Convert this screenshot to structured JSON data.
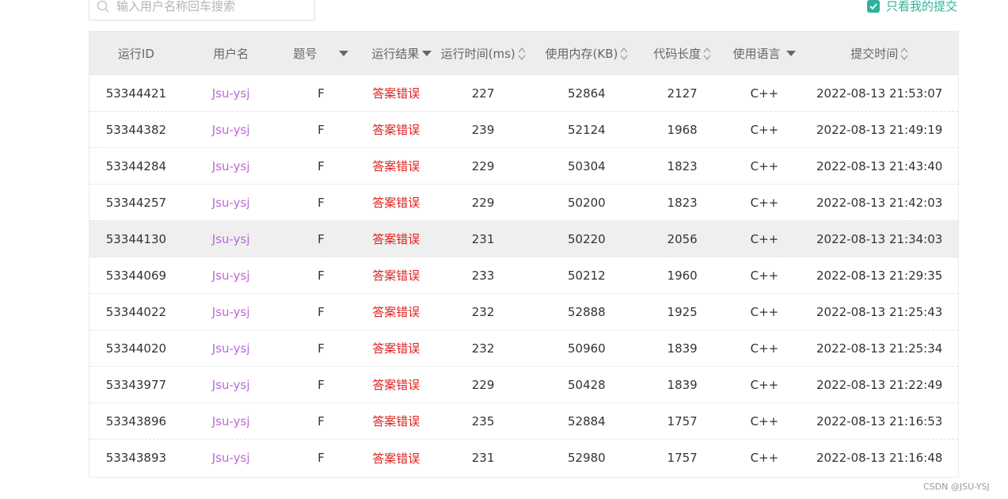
{
  "search": {
    "placeholder": "输入用户名称回车搜索"
  },
  "filter": {
    "only_mine_label": "只看我的提交",
    "checked": true
  },
  "colors": {
    "accent": "#2fb29b",
    "username": "#b96ad2",
    "result_error": "#e02020",
    "header_bg": "#ededed"
  },
  "table": {
    "headers": [
      "运行ID",
      "用户名",
      "题号",
      "运行结果",
      "运行时间(ms)",
      "使用内存(KB)",
      "代码长度",
      "使用语言",
      "提交时间"
    ],
    "rows": [
      {
        "id": "53344421",
        "user": "Jsu-ysj",
        "problem": "F",
        "result": "答案错误",
        "time": "227",
        "memory": "52864",
        "length": "2127",
        "lang": "C++",
        "submitted": "2022-08-13 21:53:07"
      },
      {
        "id": "53344382",
        "user": "Jsu-ysj",
        "problem": "F",
        "result": "答案错误",
        "time": "239",
        "memory": "52124",
        "length": "1968",
        "lang": "C++",
        "submitted": "2022-08-13 21:49:19"
      },
      {
        "id": "53344284",
        "user": "Jsu-ysj",
        "problem": "F",
        "result": "答案错误",
        "time": "229",
        "memory": "50304",
        "length": "1823",
        "lang": "C++",
        "submitted": "2022-08-13 21:43:40"
      },
      {
        "id": "53344257",
        "user": "Jsu-ysj",
        "problem": "F",
        "result": "答案错误",
        "time": "229",
        "memory": "50200",
        "length": "1823",
        "lang": "C++",
        "submitted": "2022-08-13 21:42:03"
      },
      {
        "id": "53344130",
        "user": "Jsu-ysj",
        "problem": "F",
        "result": "答案错误",
        "time": "231",
        "memory": "50220",
        "length": "2056",
        "lang": "C++",
        "submitted": "2022-08-13 21:34:03"
      },
      {
        "id": "53344069",
        "user": "Jsu-ysj",
        "problem": "F",
        "result": "答案错误",
        "time": "233",
        "memory": "50212",
        "length": "1960",
        "lang": "C++",
        "submitted": "2022-08-13 21:29:35"
      },
      {
        "id": "53344022",
        "user": "Jsu-ysj",
        "problem": "F",
        "result": "答案错误",
        "time": "232",
        "memory": "52888",
        "length": "1925",
        "lang": "C++",
        "submitted": "2022-08-13 21:25:43"
      },
      {
        "id": "53344020",
        "user": "Jsu-ysj",
        "problem": "F",
        "result": "答案错误",
        "time": "232",
        "memory": "50960",
        "length": "1839",
        "lang": "C++",
        "submitted": "2022-08-13 21:25:34"
      },
      {
        "id": "53343977",
        "user": "Jsu-ysj",
        "problem": "F",
        "result": "答案错误",
        "time": "229",
        "memory": "50428",
        "length": "1839",
        "lang": "C++",
        "submitted": "2022-08-13 21:22:49"
      },
      {
        "id": "53343896",
        "user": "Jsu-ysj",
        "problem": "F",
        "result": "答案错误",
        "time": "235",
        "memory": "52884",
        "length": "1757",
        "lang": "C++",
        "submitted": "2022-08-13 21:16:53"
      },
      {
        "id": "53343893",
        "user": "Jsu-ysj",
        "problem": "F",
        "result": "答案错误",
        "time": "231",
        "memory": "52980",
        "length": "1757",
        "lang": "C++",
        "submitted": "2022-08-13 21:16:48"
      }
    ]
  },
  "watermark": "CSDN @JSU-YSJ"
}
